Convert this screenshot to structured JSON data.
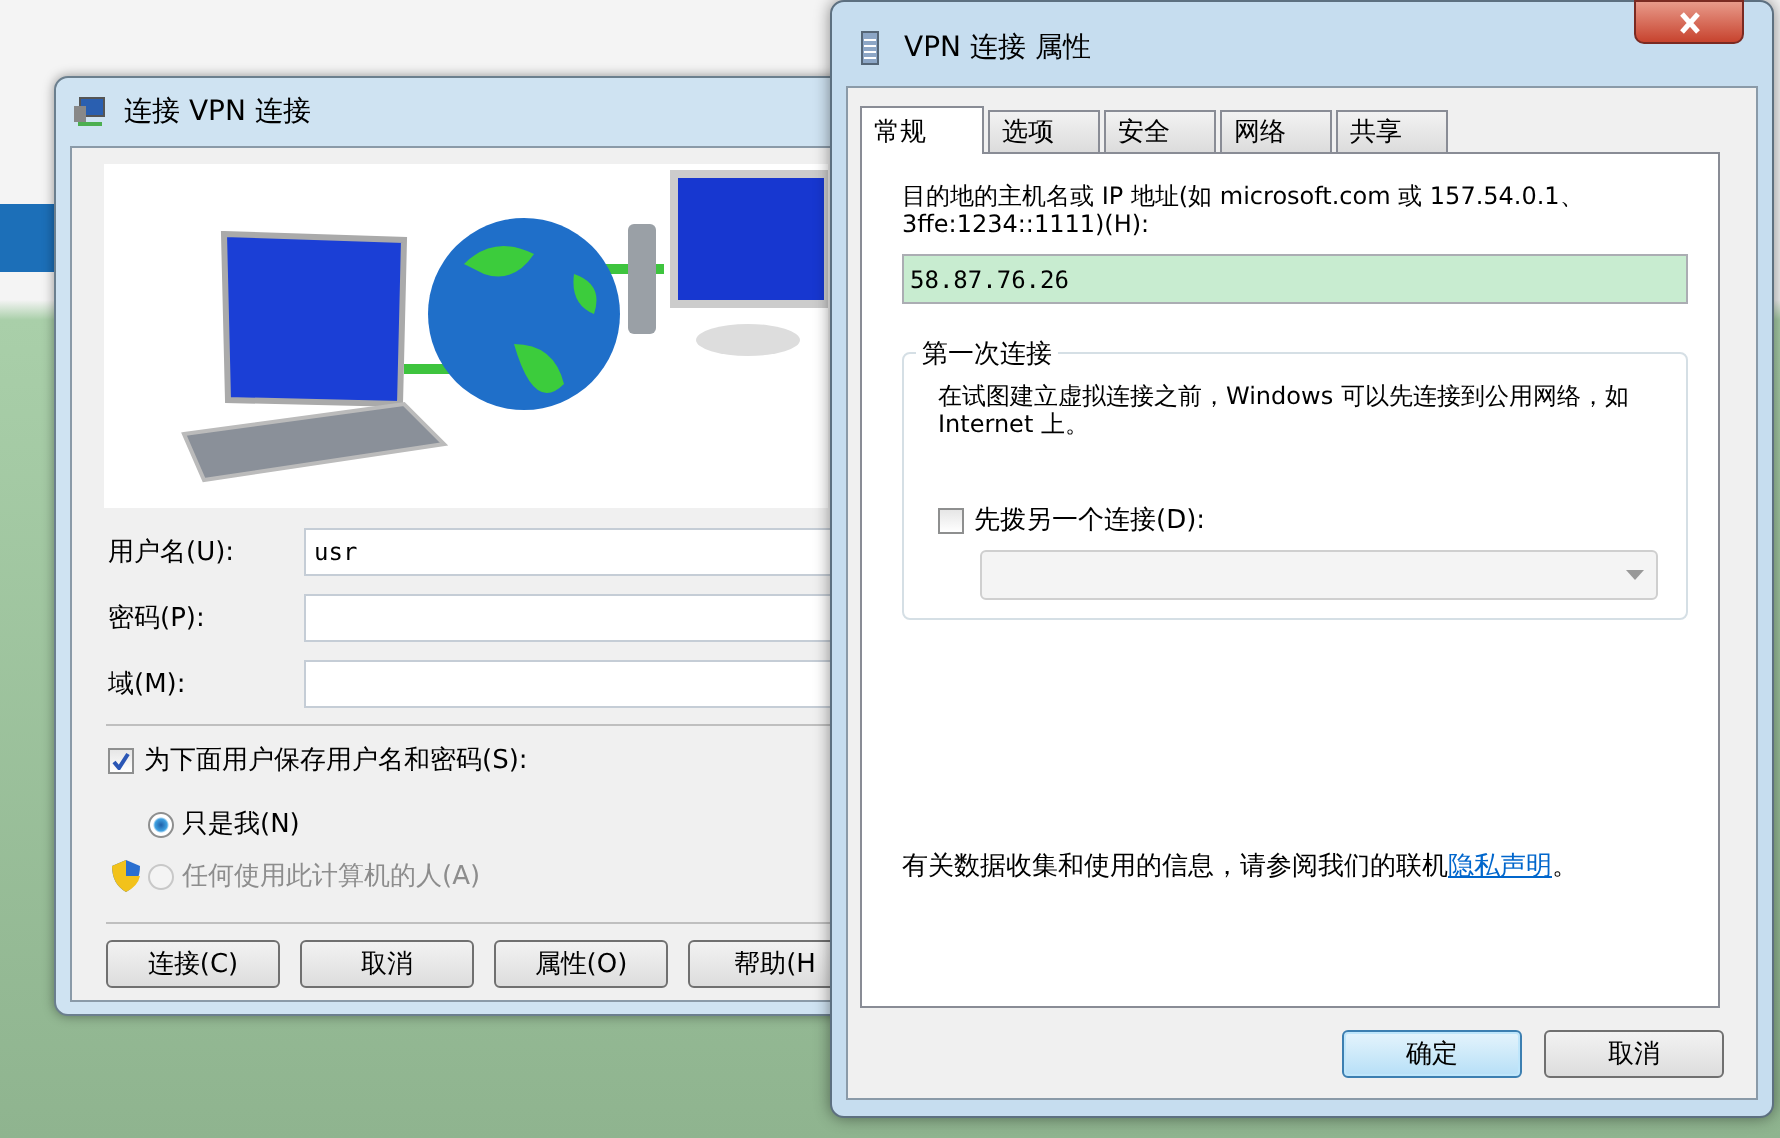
{
  "connect_window": {
    "title": "连接 VPN 连接",
    "fields": [
      {
        "label": "用户名(U):",
        "value": "usr"
      },
      {
        "label": "密码(P):"
      },
      {
        "label": "域(M):"
      }
    ],
    "save_credentials": {
      "label": "为下面用户保存用户名和密码(S):",
      "checked": true
    },
    "save_for": [
      {
        "label": "只是我(N)",
        "selected": true,
        "disabled": false,
        "shield": false
      },
      {
        "label": "任何使用此计算机的人(A)",
        "selected": false,
        "disabled": true,
        "shield": true
      }
    ],
    "buttons": [
      "连接(C)",
      "取消",
      "属性(O)",
      "帮助(H"
    ]
  },
  "properties_window": {
    "title": "VPN 连接 属性",
    "tabs": [
      {
        "label": "常规",
        "selected": true
      },
      {
        "label": "选项",
        "selected": false
      },
      {
        "label": "安全",
        "selected": false
      },
      {
        "label": "网络",
        "selected": false
      },
      {
        "label": "共享",
        "selected": false
      }
    ],
    "host_label": "目的地的主机名或 IP 地址(如 microsoft.com 或 157.54.0.1、3ffe:1234::1111)(H):",
    "host_value": "58.87.76.26",
    "first_connect": {
      "title": "第一次连接",
      "text": "在试图建立虚拟连接之前，Windows 可以先连接到公用网络，如 Internet 上。",
      "dial_first": {
        "label": "先拨另一个连接(D):",
        "checked": false
      }
    },
    "privacy": {
      "before": "有关数据收集和使用的信息，请参阅我们的联机",
      "link": "隐私声明",
      "after": "。"
    },
    "buttons": [
      {
        "label": "确定",
        "default": true
      },
      {
        "label": "取消",
        "default": false
      }
    ]
  }
}
